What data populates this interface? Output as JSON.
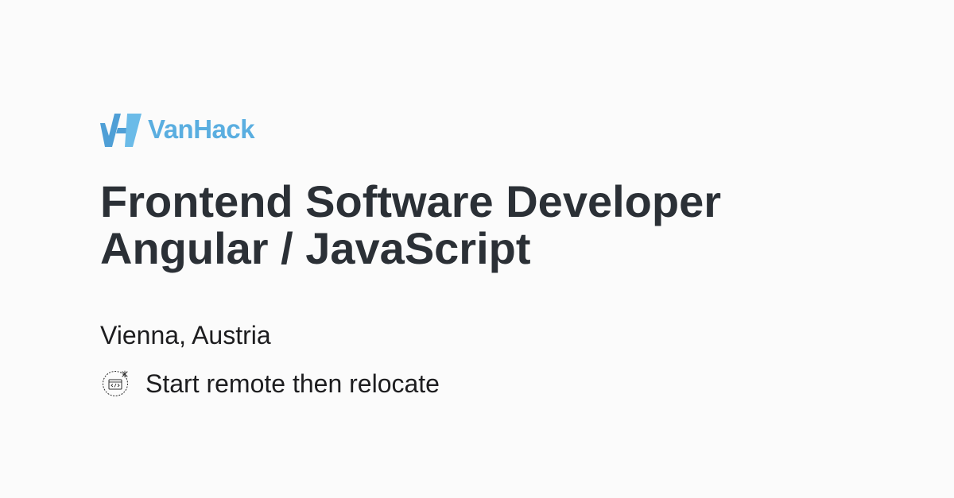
{
  "brand": {
    "name": "VanHack",
    "color": "#5aaee0"
  },
  "job": {
    "title_line_1": "Frontend Software Developer",
    "title_line_2": "Angular / JavaScript",
    "location": "Vienna, Austria",
    "work_mode": "Start remote then relocate",
    "work_mode_icon": "remote-code-relocate-icon"
  },
  "colors": {
    "background": "#fbfbfb",
    "title": "#2b3036",
    "body_text": "#1d1d1f"
  }
}
